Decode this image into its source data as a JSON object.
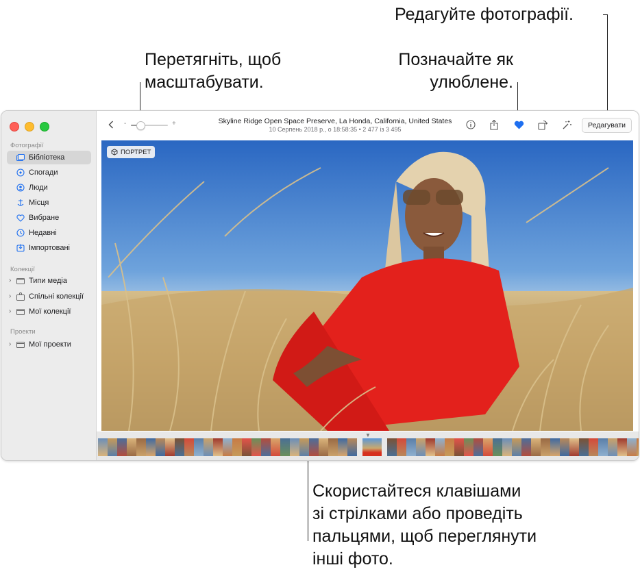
{
  "callouts": {
    "zoom": [
      "Перетягніть, щоб",
      "масштабувати."
    ],
    "favorite": [
      "Позначайте як",
      "улюблене."
    ],
    "edit": [
      "Редагуйте фотографії."
    ],
    "navigate": [
      "Скористайтеся клавішами",
      "зі стрілками або проведіть",
      "пальцями, щоб переглянути",
      "інші фото."
    ]
  },
  "sidebar": {
    "sections": {
      "photos": "Фотографії",
      "collections": "Колекції",
      "projects": "Проекти"
    },
    "items": [
      {
        "label": "Бібліотека",
        "icon": "library-icon",
        "active": true
      },
      {
        "label": "Спогади",
        "icon": "memories-icon"
      },
      {
        "label": "Люди",
        "icon": "people-icon"
      },
      {
        "label": "Місця",
        "icon": "places-icon"
      },
      {
        "label": "Вибране",
        "icon": "heart-icon"
      },
      {
        "label": "Недавні",
        "icon": "clock-icon"
      },
      {
        "label": "Імпортовані",
        "icon": "import-icon"
      }
    ],
    "collections": [
      {
        "label": "Типи медіа",
        "icon": "folder-icon"
      },
      {
        "label": "Спільні колекції",
        "icon": "shared-icon"
      },
      {
        "label": "Мої колекції",
        "icon": "folder-icon"
      }
    ],
    "projects": [
      {
        "label": "Мої проекти",
        "icon": "folder-icon"
      }
    ]
  },
  "toolbar": {
    "title": "Skyline Ridge Open Space Preserve, La Honda, California, United States",
    "subtitle": "10 Серпень 2018 р., о 18:58:35   •   2 477 із 3 495",
    "zoom_minus": "-",
    "zoom_plus": "+",
    "zoom_level": 0.25,
    "edit_label": "Редагувати"
  },
  "photo": {
    "badge": "ПОРТРЕТ"
  },
  "colors": {
    "accent": "#1e6ff0",
    "sidebar_icon": "#1e6ff0"
  }
}
